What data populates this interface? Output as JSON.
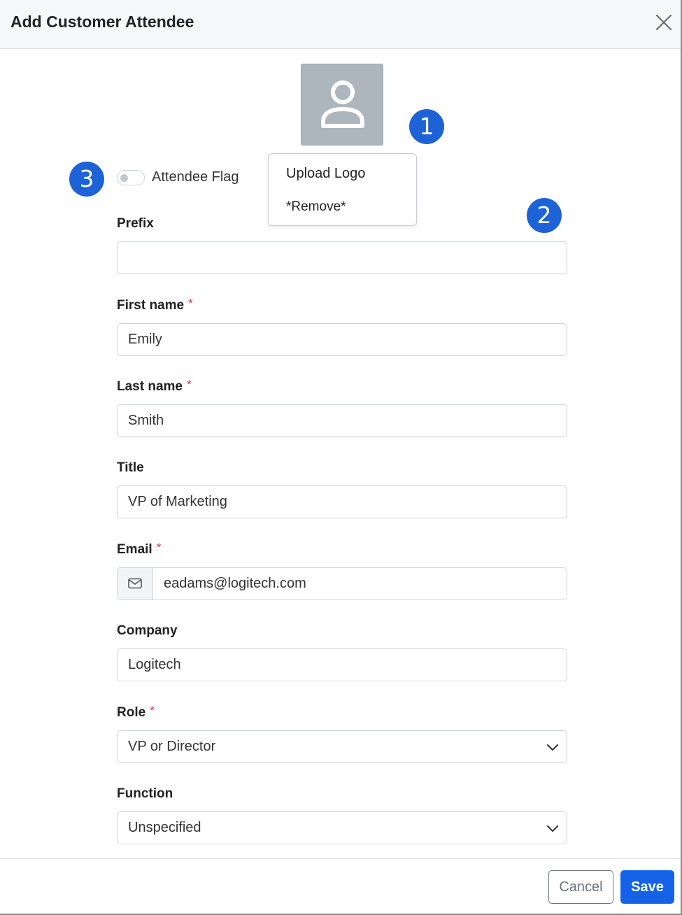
{
  "dialog": {
    "title": "Add Customer Attendee"
  },
  "logo_menu": {
    "upload_label": "Upload Logo",
    "remove_label": "*Remove*"
  },
  "callouts": [
    "1",
    "2",
    "3"
  ],
  "attendee_flag": {
    "label": "Attendee Flag",
    "checked": false
  },
  "form": {
    "prefix": {
      "label": "Prefix",
      "value": ""
    },
    "first_name": {
      "label": "First name",
      "required_mark": "*",
      "value": "Emily"
    },
    "last_name": {
      "label": "Last name",
      "required_mark": "*",
      "value": "Smith"
    },
    "title": {
      "label": "Title",
      "value": "VP of Marketing"
    },
    "email": {
      "label": "Email",
      "required_mark": "*",
      "value": "eadams@logitech.com"
    },
    "company": {
      "label": "Company",
      "value": "Logitech"
    },
    "role": {
      "label": "Role",
      "required_mark": "*",
      "value": "VP or Director"
    },
    "function": {
      "label": "Function",
      "value": "Unspecified"
    }
  },
  "footer": {
    "cancel_label": "Cancel",
    "save_label": "Save"
  },
  "colors": {
    "primary": "#1662e6",
    "callout": "#1d62d6",
    "required": "#dc3545"
  }
}
